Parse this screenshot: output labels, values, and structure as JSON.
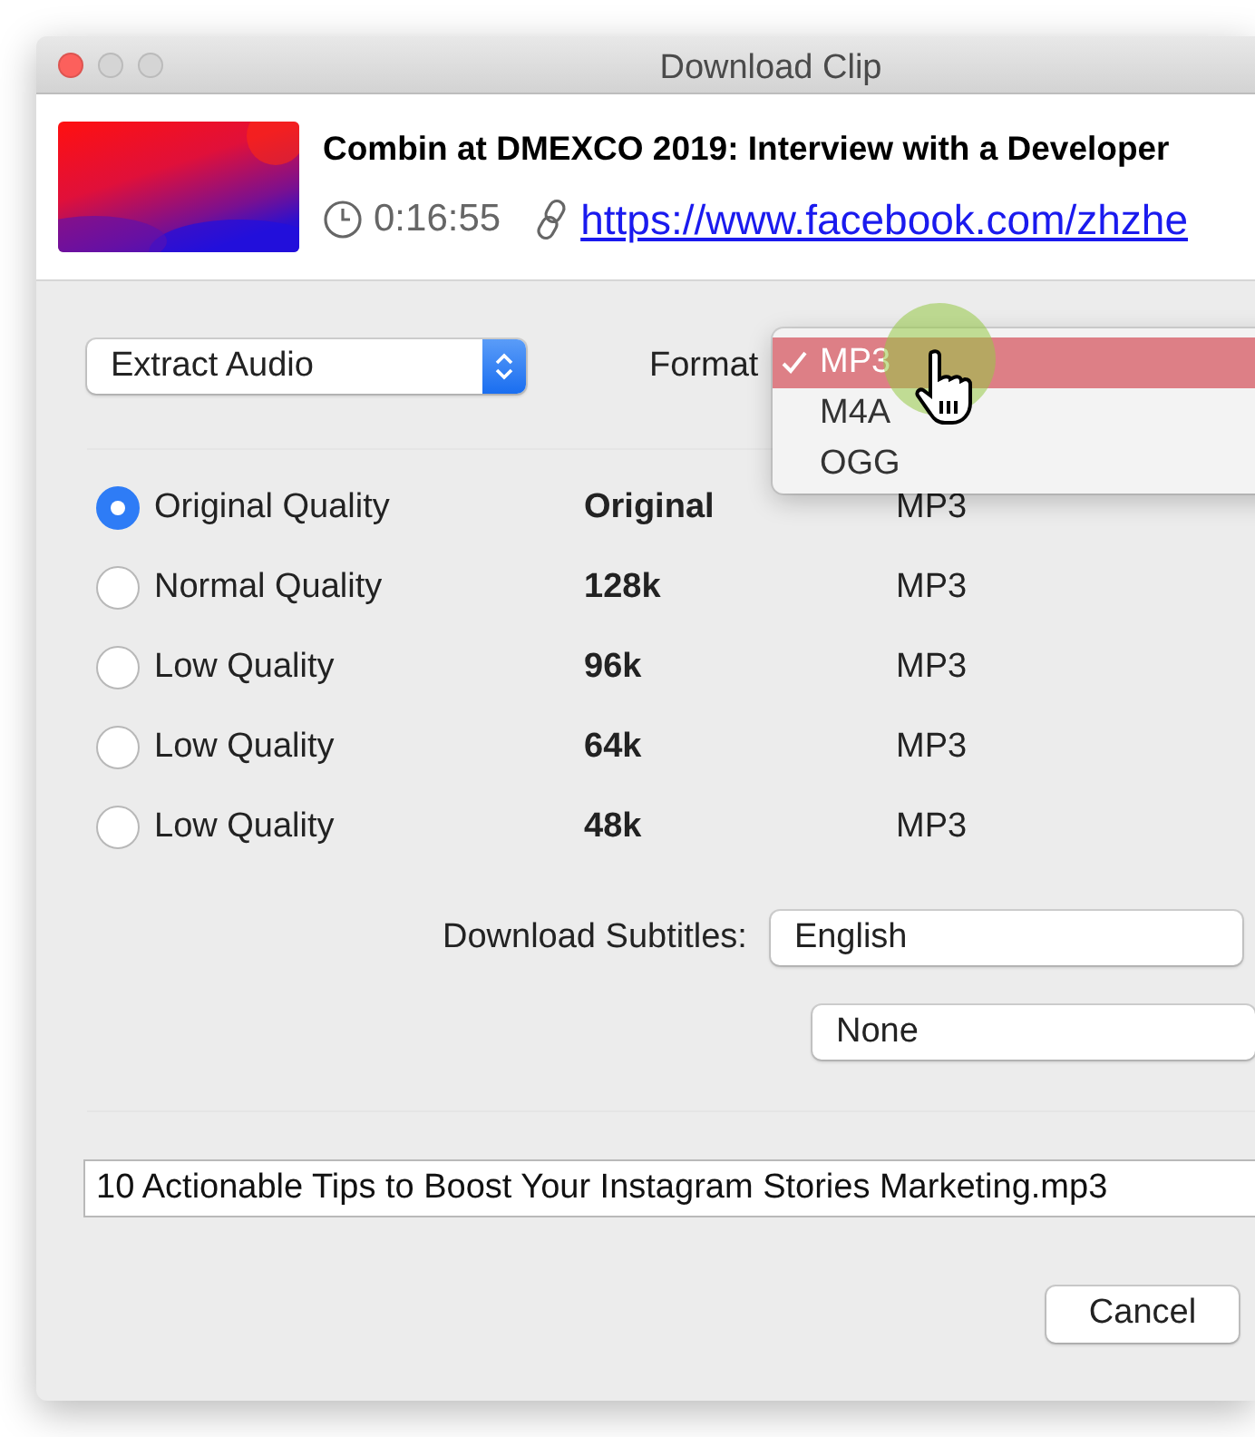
{
  "window": {
    "title": "Download Clip"
  },
  "clip": {
    "title": "Combin at DMEXCO 2019: Interview with a Developer",
    "duration": "0:16:55",
    "url": "https://www.facebook.com/zhzhe"
  },
  "mode_select": {
    "value": "Extract Audio"
  },
  "format": {
    "label": "Format",
    "menu": [
      {
        "label": "MP3",
        "selected": true
      },
      {
        "label": "M4A",
        "selected": false
      },
      {
        "label": "OGG",
        "selected": false
      }
    ]
  },
  "qualities": [
    {
      "label": "Original Quality",
      "bitrate": "Original",
      "format": "MP3",
      "selected": true
    },
    {
      "label": "Normal Quality",
      "bitrate": "128k",
      "format": "MP3",
      "selected": false
    },
    {
      "label": "Low Quality",
      "bitrate": "96k",
      "format": "MP3",
      "selected": false
    },
    {
      "label": "Low Quality",
      "bitrate": "64k",
      "format": "MP3",
      "selected": false
    },
    {
      "label": "Low Quality",
      "bitrate": "48k",
      "format": "MP3",
      "selected": false
    }
  ],
  "subtitles": {
    "label": "Download Subtitles:",
    "language": "English",
    "secondary": "None"
  },
  "filename": "10 Actionable Tips to Boost Your Instagram Stories Marketing.mp3",
  "buttons": [
    "Cancel"
  ]
}
